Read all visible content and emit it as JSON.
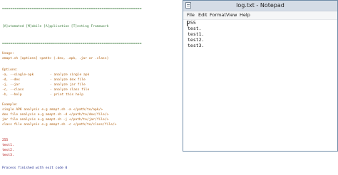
{
  "console": {
    "separator_top": "==================================================================",
    "banner": "[A]utomated [M]obile [A]pplication [T]esting Framework",
    "separator_mid": "==================================================================",
    "usage_label": "Usage:",
    "usage_line": "amapt.sh [options] <path> (.dex, .apk, .jar or .class)",
    "options_label": "Options:",
    "options": [
      {
        "flag": "-a, --single-apk",
        "desc": "- analyze single apk"
      },
      {
        "flag": "-d, --dex",
        "desc": "- analyze dex file"
      },
      {
        "flag": "-j, --jar",
        "desc": "- analyze jar file"
      },
      {
        "flag": "-c, --class",
        "desc": "- analyze class file"
      },
      {
        "flag": "-h, --help",
        "desc": "- print this help"
      }
    ],
    "example_label": "Example:",
    "examples": [
      "single APK analysis e.g amapt.sh -a </path/to/apk/>",
      "dex file analysis e.g amapt.sh -d </path/to/dex/file/>",
      "jar file analysis e.g amapt.sh -j </path/to/jar/file/>",
      "class file analysis e.g amapt.sh -c </path/to/class/file/>"
    ],
    "output_lines": [
      "255",
      "test1.",
      "test2.",
      "test3."
    ],
    "finished": "Process finished with exit code 0"
  },
  "notepad": {
    "title": "log.txt - Notepad",
    "menu": [
      "File",
      "Edit",
      "Format",
      "View",
      "Help"
    ],
    "lines": [
      "255",
      "test.",
      "test1.",
      "test2.",
      "test3."
    ]
  }
}
